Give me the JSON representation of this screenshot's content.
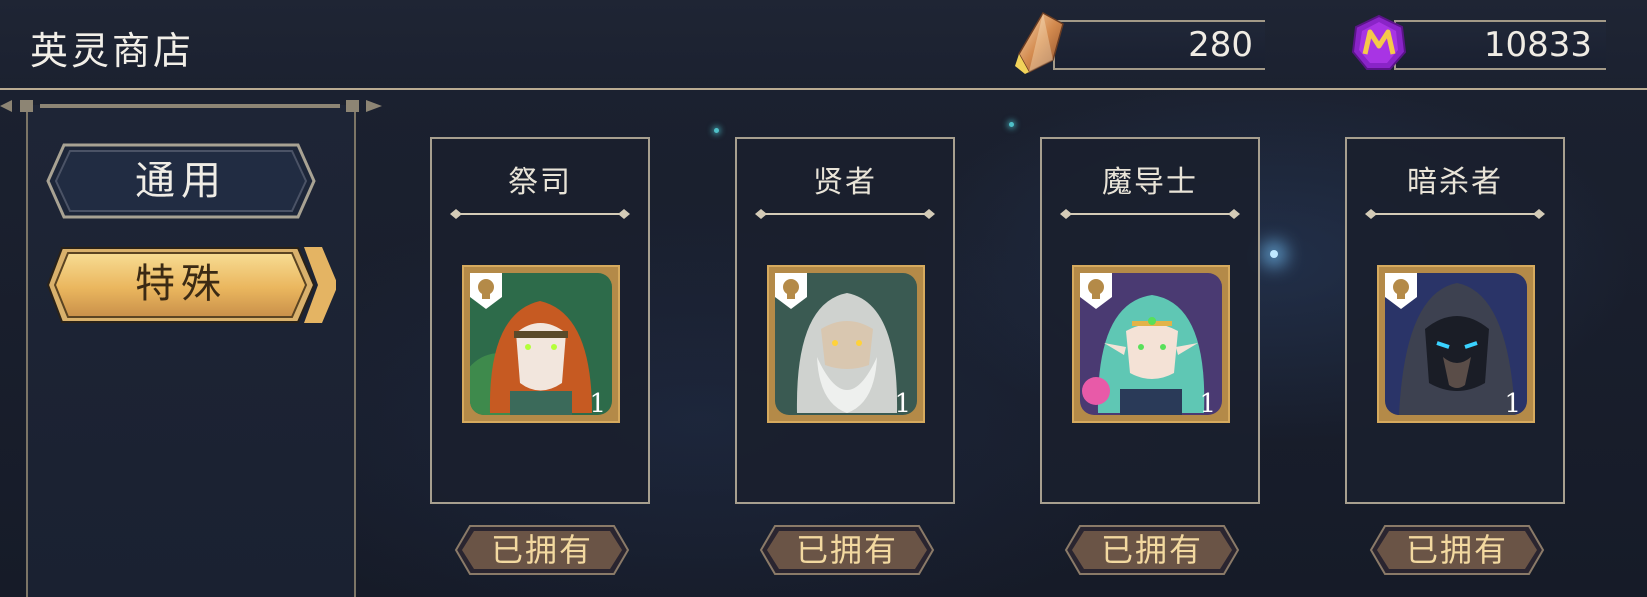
{
  "header": {
    "title": "英灵商店",
    "crystal_amount": "280",
    "gem_amount": "10833"
  },
  "tabs": [
    {
      "label": "通用",
      "selected": false
    },
    {
      "label": "特殊",
      "selected": true
    }
  ],
  "heroes": [
    {
      "name": "祭司",
      "level": "1",
      "status": "已拥有",
      "icon": "druid-portrait",
      "palette": "#2d6b4a"
    },
    {
      "name": "贤者",
      "level": "1",
      "status": "已拥有",
      "icon": "sage-portrait",
      "palette": "#3a5a52"
    },
    {
      "name": "魔导士",
      "level": "1",
      "status": "已拥有",
      "icon": "mage-portrait",
      "palette": "#4a3a72"
    },
    {
      "name": "暗杀者",
      "level": "1",
      "status": "已拥有",
      "icon": "assassin-portrait",
      "palette": "#2a3468"
    }
  ],
  "colors": {
    "accent_gold": "#f0c870",
    "frame": "#a79f8f",
    "owned_button": "#6a5446"
  }
}
